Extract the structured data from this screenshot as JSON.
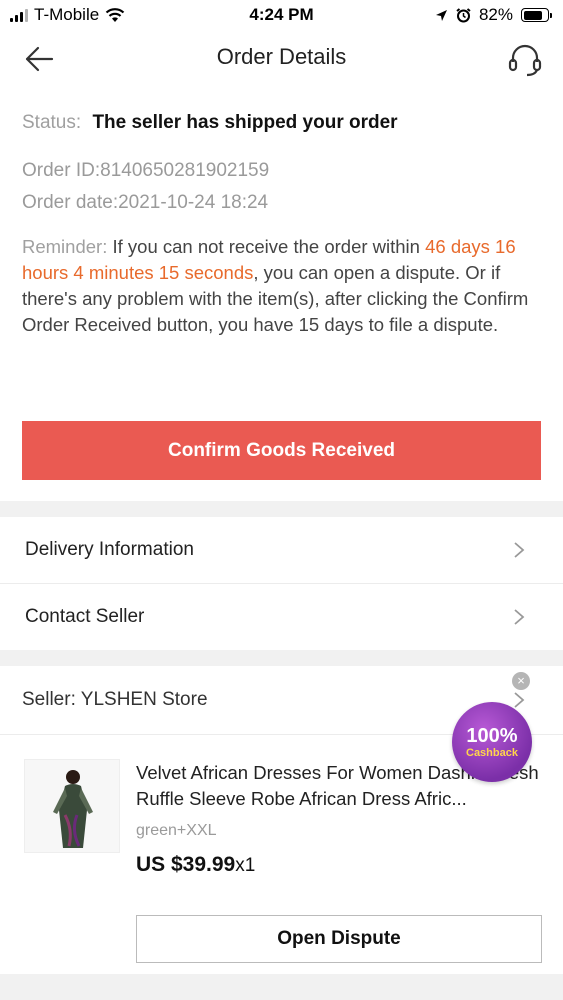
{
  "status_bar": {
    "carrier": "T-Mobile",
    "time": "4:24 PM",
    "battery": "82%",
    "battery_level": 0.82
  },
  "header": {
    "title": "Order Details"
  },
  "order": {
    "status_label": "Status:",
    "status_value": "The seller has shipped your order",
    "order_id": "Order ID:8140650281902159",
    "order_date": "Order date:2021-10-24 18:24",
    "reminder_label": "Reminder:",
    "reminder_text_1": " If you can not receive the order within ",
    "reminder_highlight": "46 days 16 hours 4 minutes 15 seconds",
    "reminder_text_2": ", you can open a dispute. Or if there's any problem with the item(s), after clicking the Confirm Order Received button, you have 15 days to file a dispute."
  },
  "actions": {
    "confirm_label": "Confirm Goods Received",
    "dispute_label": "Open Dispute"
  },
  "rows": {
    "delivery": "Delivery Information",
    "contact": "Contact Seller"
  },
  "seller": {
    "name": "Seller: YLSHEN Store"
  },
  "product": {
    "title": "Velvet African Dresses For Women Dashiki Mesh Ruffle Sleeve Robe African Dress Afric...",
    "variant": "green+XXL",
    "price": "US $39.99",
    "quantity": "x1"
  },
  "cashback_badge": {
    "percent": "100%",
    "label": "Cashback"
  },
  "colors": {
    "accent_red": "#ea5a52",
    "highlight_orange": "#e86a2c",
    "badge_purple": "#7b2fa8"
  }
}
